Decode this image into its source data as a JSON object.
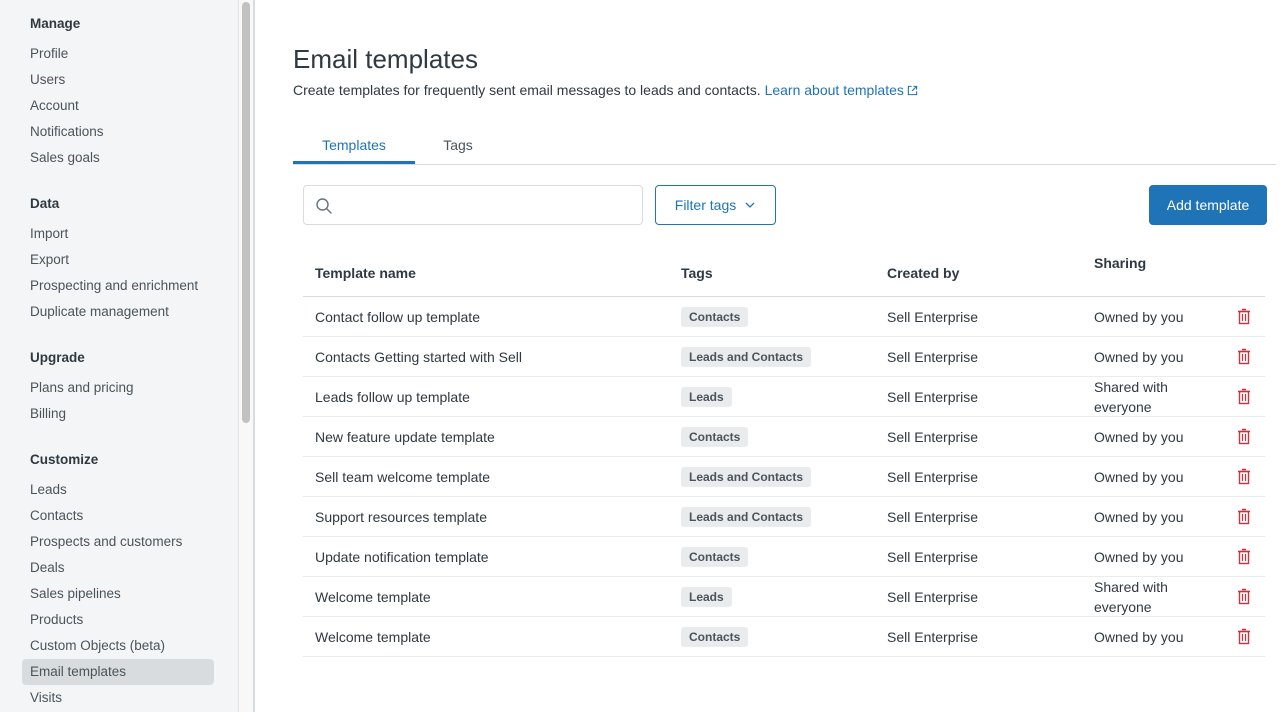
{
  "sidebar": {
    "sections": [
      {
        "title": "Manage",
        "items": [
          "Profile",
          "Users",
          "Account",
          "Notifications",
          "Sales goals"
        ]
      },
      {
        "title": "Data",
        "items": [
          "Import",
          "Export",
          "Prospecting and enrichment",
          "Duplicate management"
        ]
      },
      {
        "title": "Upgrade",
        "items": [
          "Plans and pricing",
          "Billing"
        ]
      },
      {
        "title": "Customize",
        "items": [
          "Leads",
          "Contacts",
          "Prospects and customers",
          "Deals",
          "Sales pipelines",
          "Products",
          "Custom Objects (beta)",
          "Email templates",
          "Visits"
        ]
      }
    ],
    "active_item": "Email templates"
  },
  "header": {
    "title": "Email templates",
    "subtitle": "Create templates for frequently sent email messages to leads and contacts.",
    "learn_link": "Learn about templates",
    "link_icon": "external-link-icon"
  },
  "tabs": [
    {
      "label": "Templates",
      "active": true
    },
    {
      "label": "Tags",
      "active": false
    }
  ],
  "toolbar": {
    "search_value": "",
    "search_placeholder": "",
    "search_icon": "search-icon",
    "filter_label": "Filter tags",
    "add_label": "Add template"
  },
  "colors": {
    "accent": "#1f73b7",
    "delete": "#cc3340",
    "sidebar_bg": "#f3f5f7",
    "tag_bg": "#e9ebed"
  },
  "table": {
    "columns": [
      "Template name",
      "Tags",
      "Created by",
      "Sharing"
    ],
    "rows": [
      {
        "name": "Contact follow up template",
        "tag": "Contacts",
        "created_by": "Sell Enterprise",
        "sharing": "Owned by you"
      },
      {
        "name": "Contacts Getting started with Sell",
        "tag": "Leads and Contacts",
        "created_by": "Sell Enterprise",
        "sharing": "Owned by you"
      },
      {
        "name": "Leads follow up template",
        "tag": "Leads",
        "created_by": "Sell Enterprise",
        "sharing": "Shared with everyone"
      },
      {
        "name": "New feature update template",
        "tag": "Contacts",
        "created_by": "Sell Enterprise",
        "sharing": "Owned by you"
      },
      {
        "name": "Sell team welcome template",
        "tag": "Leads and Contacts",
        "created_by": "Sell Enterprise",
        "sharing": "Owned by you"
      },
      {
        "name": "Support resources template",
        "tag": "Leads and Contacts",
        "created_by": "Sell Enterprise",
        "sharing": "Owned by you"
      },
      {
        "name": "Update notification template",
        "tag": "Contacts",
        "created_by": "Sell Enterprise",
        "sharing": "Owned by you"
      },
      {
        "name": "Welcome template",
        "tag": "Leads",
        "created_by": "Sell Enterprise",
        "sharing": "Shared with everyone"
      },
      {
        "name": "Welcome template",
        "tag": "Contacts",
        "created_by": "Sell Enterprise",
        "sharing": "Owned by you"
      }
    ]
  }
}
